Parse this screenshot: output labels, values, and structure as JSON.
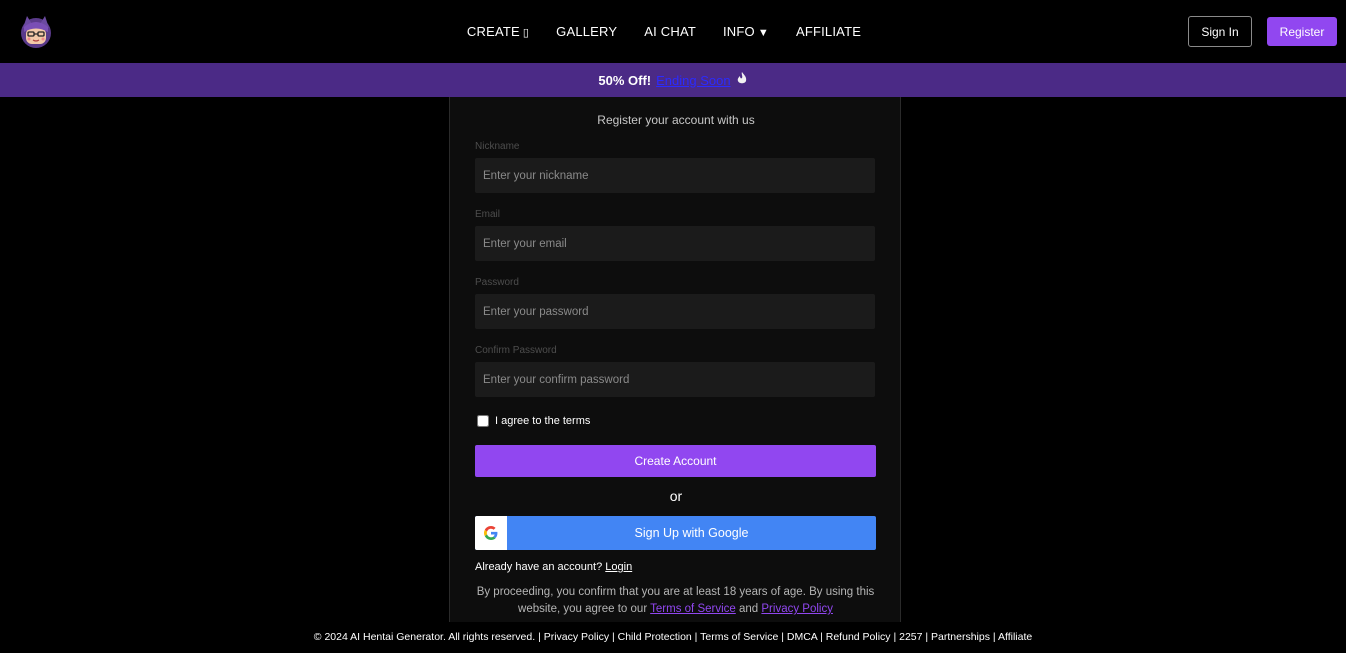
{
  "header": {
    "logo_icon": "anime-girl-avatar-icon",
    "nav": [
      {
        "label": "CREATE",
        "glyph": "▯"
      },
      {
        "label": "GALLERY",
        "glyph": ""
      },
      {
        "label": "AI CHAT",
        "glyph": ""
      },
      {
        "label": "INFO",
        "glyph": "▼"
      },
      {
        "label": "AFFILIATE",
        "glyph": ""
      }
    ],
    "signin_label": "Sign In",
    "register_label": "Register"
  },
  "promo": {
    "offer": "50% Off!",
    "link": "Ending Soon",
    "icon": "fire-icon"
  },
  "form": {
    "subtitle": "Register your account with us",
    "fields": [
      {
        "label": "Nickname",
        "placeholder": "Enter your nickname",
        "value": ""
      },
      {
        "label": "Email",
        "placeholder": "Enter your email",
        "value": ""
      },
      {
        "label": "Password",
        "placeholder": "Enter your password",
        "value": ""
      },
      {
        "label": "Confirm Password",
        "placeholder": "Enter your confirm password",
        "value": ""
      }
    ],
    "terms_label": "I agree to the terms",
    "create_label": "Create Account",
    "or_label": "or",
    "google_label": "Sign Up with Google",
    "login_prompt": "Already have an account?",
    "login_link": "Login",
    "disclaimer_pre": "By proceeding, you confirm that you are at least 18 years of age. By using this website, you agree to our",
    "disclaimer_tos": "Terms of Service",
    "disclaimer_and": "and",
    "disclaimer_privacy": "Privacy Policy"
  },
  "footer": {
    "text": "© 2024 AI Hentai Generator. All rights reserved. | Privacy Policy | Child Protection | Terms of Service | DMCA | Refund Policy | 2257 | Partnerships | Affiliate"
  },
  "colors": {
    "accent": "#9147f0",
    "promo_bg": "#4b2a86",
    "google_blue": "#4285f4"
  }
}
